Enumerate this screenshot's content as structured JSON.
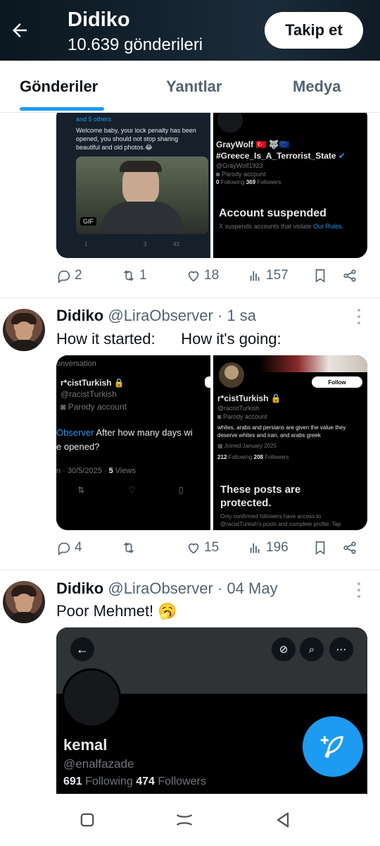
{
  "header": {
    "title": "Didiko",
    "subtitle": "10.639 gönderileri",
    "follow_label": "Takip et"
  },
  "tabs": [
    {
      "label": "Gönderiler",
      "active": true
    },
    {
      "label": "Yanıtlar",
      "active": false
    },
    {
      "label": "Medya",
      "active": false
    }
  ],
  "colors": {
    "accent": "#1d9bf0",
    "header_bg": "#13222e",
    "text": "#0f1419",
    "muted": "#536471"
  },
  "post1": {
    "left_shot": {
      "others": "and 5 others",
      "line1": "Welcome baby, your lock penalty has been",
      "line2": "opened, you should not stop sharing",
      "line3": "beautiful and old photos.😂",
      "gif": "GIF",
      "stats": [
        "1",
        "3",
        "43"
      ]
    },
    "right_shot": {
      "name": "GrayWolf 🇹🇷 🐺🇪🇺",
      "hashtag": "#Greece_Is_A_Terrorist_State",
      "handle": "@GrayWolf1923",
      "parody": "Parody account",
      "following": "0",
      "following_label": "Following",
      "followers": "369",
      "followers_label": "Followers",
      "suspended": "Account suspended",
      "suspended_note": "X suspends accounts that violate ",
      "rules": "Our Rules."
    },
    "actions": {
      "replies": "2",
      "reposts": "1",
      "likes": "18",
      "views": "157"
    }
  },
  "post2": {
    "name": "Didiko",
    "handle": "@LiraObserver",
    "sep": "·",
    "time": "1 sa",
    "text": "How it started:      How it's going:",
    "left_shot": {
      "crumb": "onversation",
      "name": "r*cistTurkish 🔒",
      "handle": "@racistTurkish",
      "parody": "Parody account",
      "mention": "Observer",
      "line1": " After how many days wi",
      "line2": "e opened?",
      "meta": "n · 30/5/2025 · ",
      "views": "5",
      "views_label": "Views"
    },
    "right_shot": {
      "follow": "Follow",
      "name": "r*cistTurkish 🔒",
      "handle": "@racistTurkish",
      "parody": "Parody account",
      "bio1": "whites, arabs and persians are given the value they",
      "bio2": "deserve whites and iran, and arabs greek",
      "joined": "Joined January 2025",
      "following": "212",
      "following_label": "Following",
      "followers": "208",
      "followers_label": "Followers",
      "protected1": "These posts are",
      "protected2": "protected.",
      "note1": "Only confirmed followers have access to",
      "note2": "@racistTurkish's posts and complete profile. Tap"
    },
    "actions": {
      "replies": "4",
      "reposts": "",
      "likes": "15",
      "views": "196"
    }
  },
  "post3": {
    "name": "Didiko",
    "handle": "@LiraObserver",
    "sep": "·",
    "time": "04 May",
    "text": "Poor Mehmet! 🥱",
    "shot": {
      "name": "kemal",
      "handle": "@enalfazade",
      "following": "691",
      "following_label": "Following",
      "followers": "474",
      "followers_label": "Followers"
    }
  }
}
